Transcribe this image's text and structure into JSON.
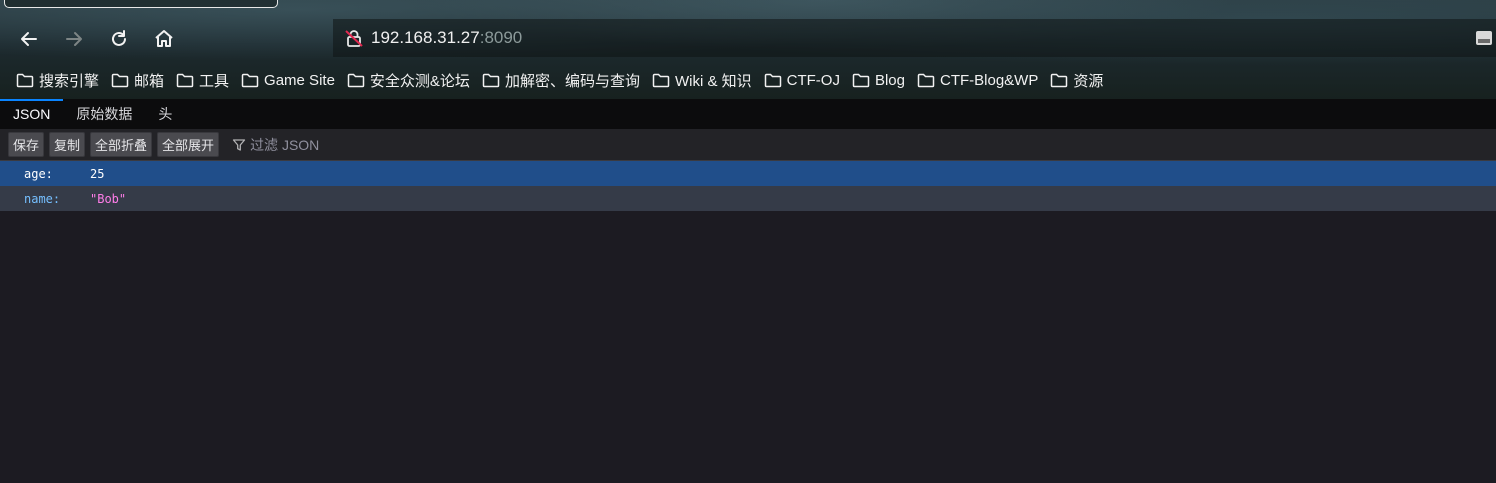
{
  "browser": {
    "url_host": "192.168.31.27",
    "url_port": ":8090"
  },
  "bookmarks": [
    {
      "label": "搜索引擎"
    },
    {
      "label": "邮箱"
    },
    {
      "label": "工具"
    },
    {
      "label": "Game Site"
    },
    {
      "label": "安全众测&论坛"
    },
    {
      "label": "加解密、编码与查询"
    },
    {
      "label": "Wiki & 知识"
    },
    {
      "label": "CTF-OJ"
    },
    {
      "label": "Blog"
    },
    {
      "label": "CTF-Blog&WP"
    },
    {
      "label": "资源"
    }
  ],
  "viewer": {
    "tabs": [
      {
        "label": "JSON"
      },
      {
        "label": "原始数据"
      },
      {
        "label": "头"
      }
    ],
    "toolbar": {
      "save_label": "保存",
      "copy_label": "复制",
      "collapse_label": "全部折叠",
      "expand_label": "全部展开",
      "filter_placeholder": "过滤 JSON"
    },
    "rows": [
      {
        "key": "age:",
        "value": "25"
      },
      {
        "key": "name:",
        "value": "\"Bob\""
      }
    ]
  },
  "colors": {
    "accent": "#0a84ff",
    "selected_row": "#204e8a",
    "string_value": "#ff7de9",
    "key_color": "#75bfff"
  }
}
